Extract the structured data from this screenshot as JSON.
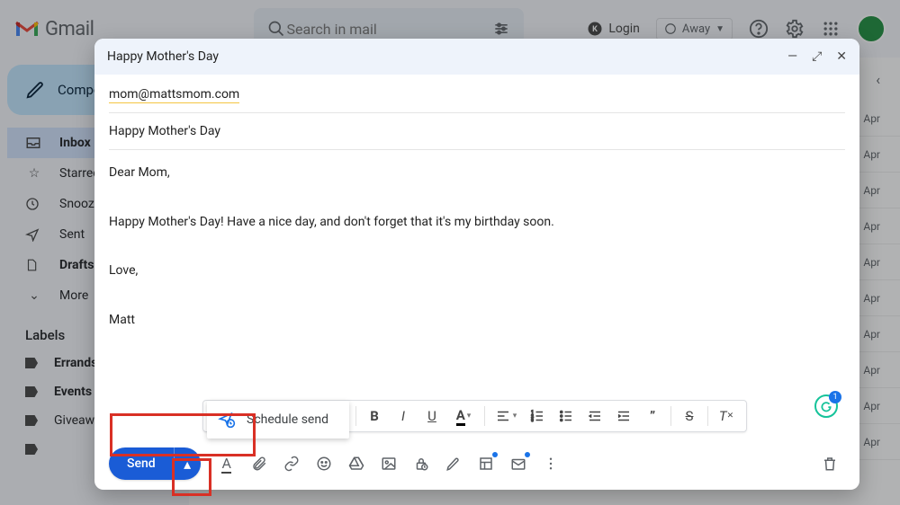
{
  "header": {
    "app_name": "Gmail",
    "search_placeholder": "Search in mail",
    "login_label": "Login",
    "status_label": "Away"
  },
  "sidebar": {
    "compose_label": "Compose",
    "items": [
      {
        "icon": "inbox",
        "label": "Inbox",
        "active": true,
        "bold": true
      },
      {
        "icon": "star",
        "label": "Starred"
      },
      {
        "icon": "clock",
        "label": "Snoozed"
      },
      {
        "icon": "send",
        "label": "Sent"
      },
      {
        "icon": "file",
        "label": "Drafts",
        "bold": true
      },
      {
        "icon": "chevron",
        "label": "More"
      }
    ],
    "labels_heading": "Labels",
    "labels": [
      {
        "label": "Errands",
        "bold": true
      },
      {
        "label": "Events",
        "bold": true
      },
      {
        "label": "Giveaways"
      },
      {
        "label": ""
      }
    ]
  },
  "maillist": {
    "date_label": "Apr"
  },
  "compose": {
    "title": "Happy Mother's Day",
    "recipient": "mom@mattsmom.com",
    "subject": "Happy Mother's Day",
    "body": "Dear Mom,\n\nHappy Mother's Day! Have a nice day, and don't forget that it's my birthday soon.\n\nLove,\n\nMatt",
    "send_label": "Send",
    "schedule_label": "Schedule send"
  }
}
